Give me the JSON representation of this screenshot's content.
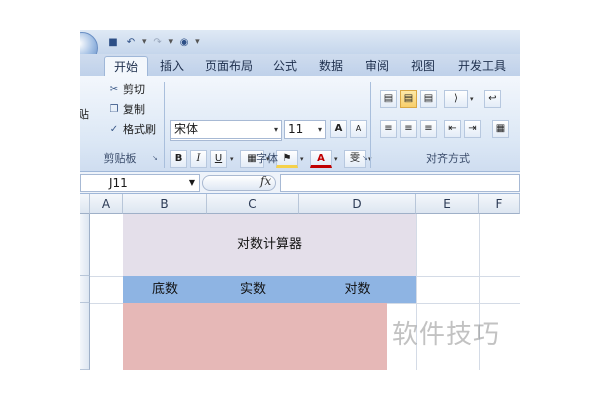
{
  "tabs": [
    "开始",
    "插入",
    "页面布局",
    "公式",
    "数据",
    "审阅",
    "视图",
    "开发工具"
  ],
  "clipboard": {
    "paste_label": "贴",
    "cut": "剪切",
    "copy": "复制",
    "format_painter": "格式刷",
    "group_label": "剪贴板"
  },
  "font": {
    "name": "宋体",
    "size": "11",
    "bold": "B",
    "italic": "I",
    "underline": "U",
    "font_color_letter": "A",
    "pinyin_glyph": "雯",
    "grow": "A",
    "shrink": "A",
    "group_label": "字体"
  },
  "alignment": {
    "group_label": "对齐方式"
  },
  "formula_bar": {
    "name_box": "J11",
    "fx": "fx"
  },
  "columns": [
    "A",
    "B",
    "C",
    "D",
    "E",
    "F"
  ],
  "sheet": {
    "title": "对数计算器",
    "headers": [
      "底数",
      "实数",
      "对数"
    ]
  },
  "watermark": "软件技巧",
  "colors": {
    "title_fill": "#e4dfea",
    "header_fill": "#8eb4e3",
    "input_fill": "#e6b8b7"
  }
}
